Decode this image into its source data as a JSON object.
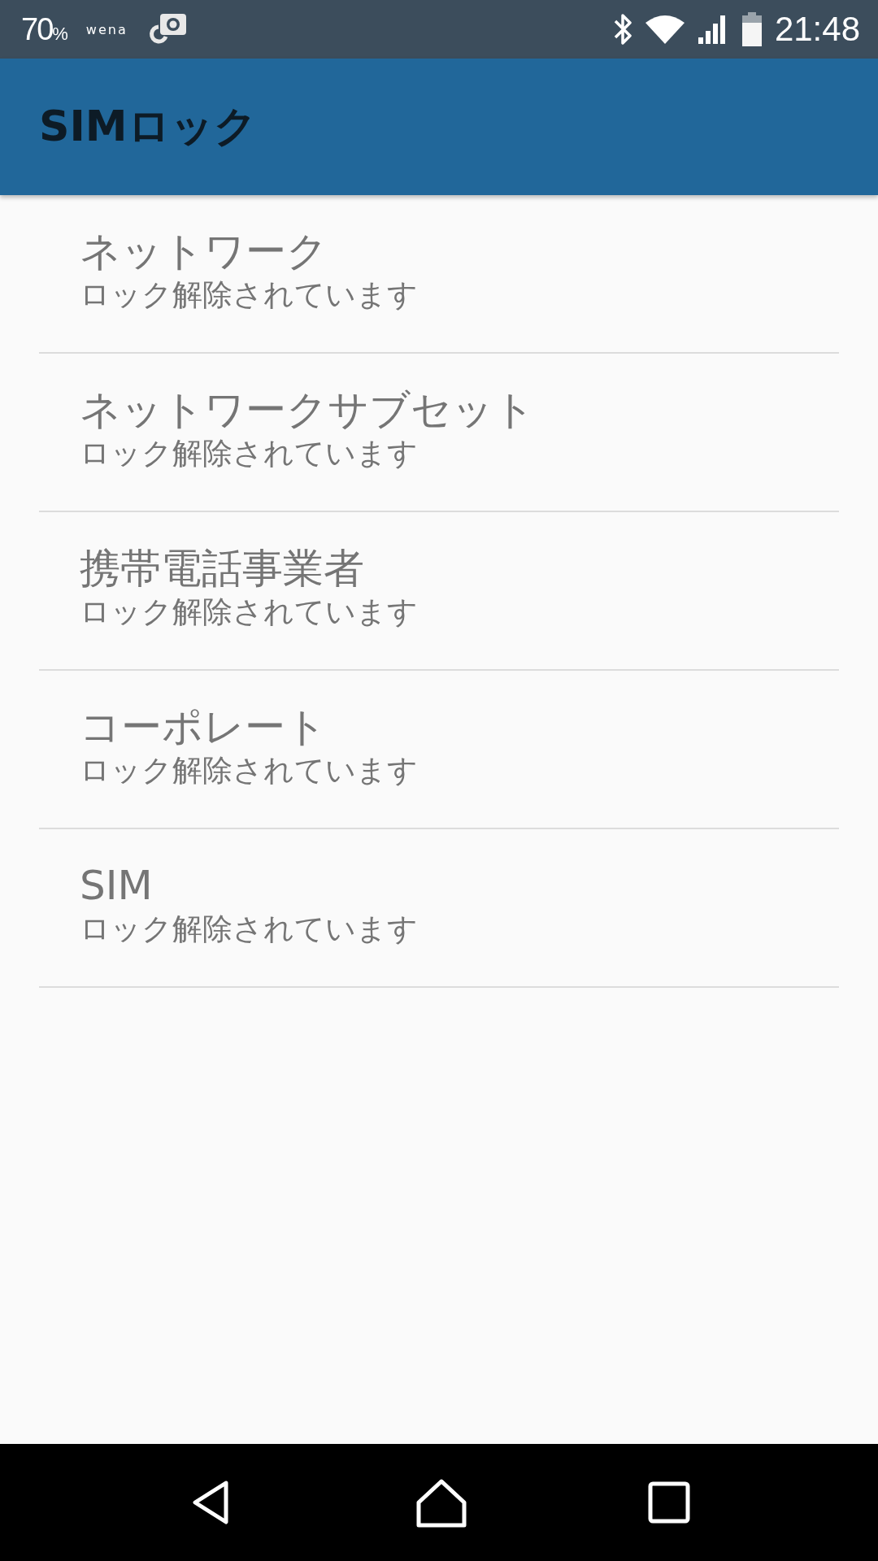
{
  "status_bar": {
    "battery_percent": "70",
    "percent_sign": "%",
    "app_label": "wena",
    "time": "21:48"
  },
  "app_bar": {
    "title": "SIMロック"
  },
  "items": [
    {
      "title": "ネットワーク",
      "summary": "ロック解除されています"
    },
    {
      "title": "ネットワークサブセット",
      "summary": "ロック解除されています"
    },
    {
      "title": "携帯電話事業者",
      "summary": "ロック解除されています"
    },
    {
      "title": "コーポレート",
      "summary": "ロック解除されています"
    },
    {
      "title": "SIM",
      "summary": "ロック解除されています"
    }
  ]
}
